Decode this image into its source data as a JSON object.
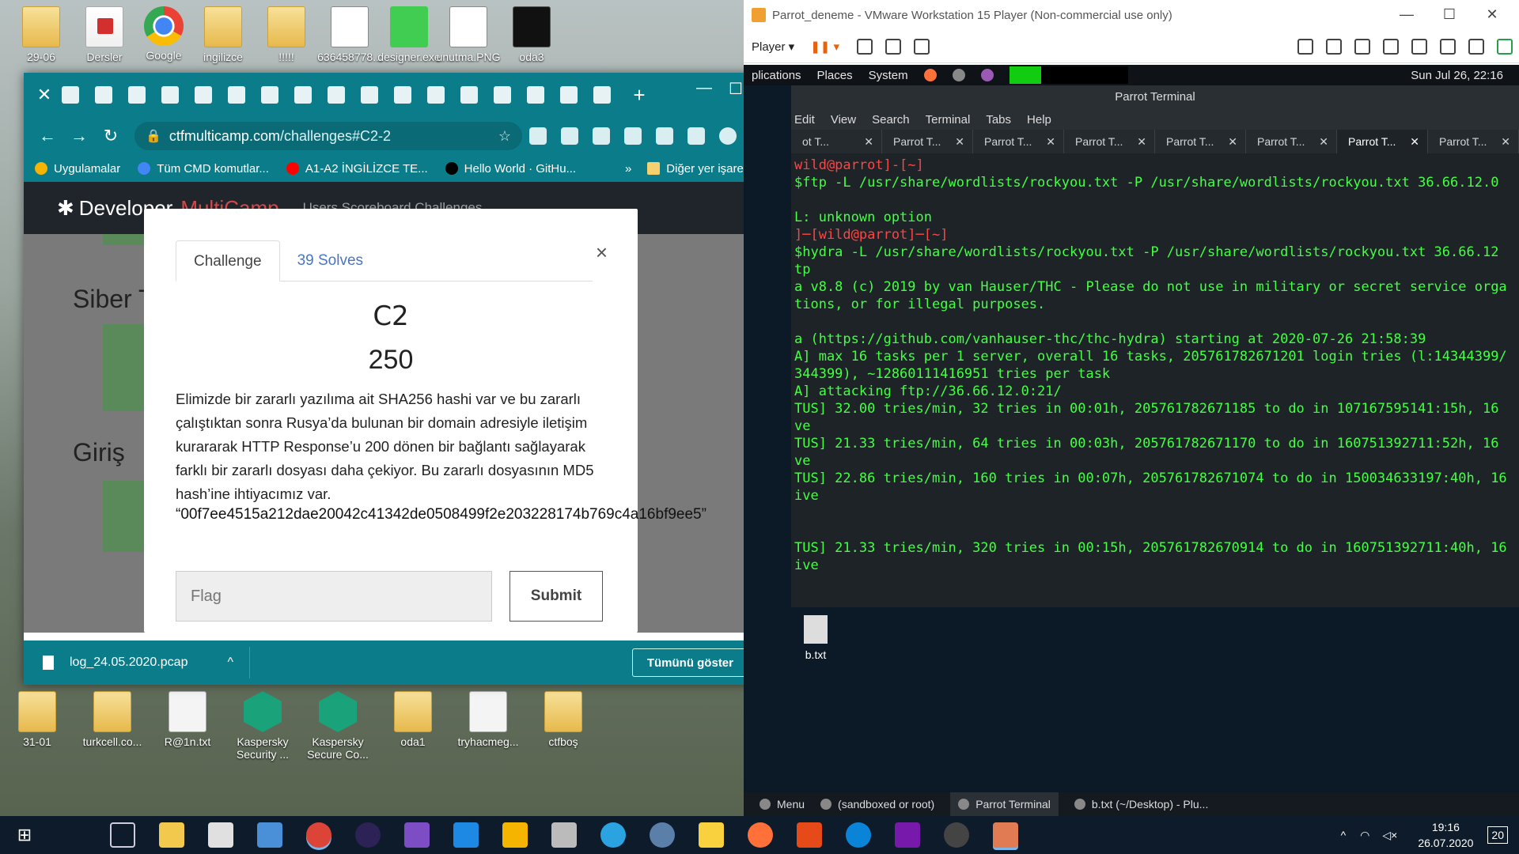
{
  "desktop": {
    "top_icons": [
      {
        "label": "29-06",
        "type": "folder"
      },
      {
        "label": "Dersler",
        "type": "pdf"
      },
      {
        "label": "Google",
        "type": "chrome"
      },
      {
        "label": "ingilizce",
        "type": "folder"
      },
      {
        "label": "!!!!!",
        "type": "folder"
      },
      {
        "label": "636458778...",
        "type": "img"
      },
      {
        "label": "designer.exe",
        "type": "qt"
      },
      {
        "label": "unutma.PNG",
        "type": "img"
      },
      {
        "label": "oda3",
        "type": "dark"
      }
    ],
    "bottom_icons": [
      {
        "label": "31-01",
        "type": "folder"
      },
      {
        "label": "turkcell.co...",
        "type": "folder"
      },
      {
        "label": "R@1n.txt",
        "type": "doc"
      },
      {
        "label": "Kaspersky Security ...",
        "type": "kas"
      },
      {
        "label": "Kaspersky Secure Co...",
        "type": "kas2"
      },
      {
        "label": "oda1",
        "type": "folder"
      },
      {
        "label": "tryhacmeg...",
        "type": "doc"
      },
      {
        "label": "ctfboş",
        "type": "folder"
      }
    ]
  },
  "chrome": {
    "tab_close": "✕",
    "new_tab": "+",
    "minimize": "—",
    "maximize": "☐",
    "close": "✕",
    "back": "←",
    "forward": "→",
    "reload": "↻",
    "url_host": "ctfmulticamp.com",
    "url_path": "/challenges#C2-2",
    "star": "☆",
    "menu": "⋮",
    "bookmarks": [
      {
        "label": "Uygulamalar",
        "color": "#f4b400"
      },
      {
        "label": "Tüm CMD komutlar...",
        "color": "#4285f4"
      },
      {
        "label": "A1-A2 İNGİLİZCE TE...",
        "color": "#ff0000"
      },
      {
        "label": "Hello World · GitHu...",
        "color": "#000000"
      }
    ],
    "more_bookmarks": "»",
    "other_bookmarks": "Diğer yer işaretleri"
  },
  "site": {
    "brand": "Developer",
    "brand_accent": "MultiCamp",
    "nav": "Users   Scoreboard   Challenges",
    "heading1": "Siber T",
    "heading2": "Giriş"
  },
  "modal": {
    "tab_challenge": "Challenge",
    "tab_solves": "39 Solves",
    "close": "×",
    "name": "C2",
    "value": "250",
    "description": "Elimizde bir zararlı yazılıma ait SHA256 hashi var ve bu zararlı çalıştıktan sonra Rusya’da bulunan bir domain adresiyle iletişim kurararak HTTP Response’u 200 dönen bir bağlantı sağlayarak farklı bir zararlı dosyası daha çekiyor. Bu zararlı dosyasının MD5 hash’ine ihtiyacımız var.",
    "hash": "“00f7ee4515a212dae20042c41342de0508499f2e203228174b769c4a16bf9ee5”",
    "flag_placeholder": "Flag",
    "submit": "Submit"
  },
  "download_bar": {
    "file": "log_24.05.2020.pcap",
    "chevron": "^",
    "show_all": "Tümünü göster",
    "close": "✕"
  },
  "vmware": {
    "title": "Parrot_deneme - VMware Workstation 15 Player (Non-commercial use only)",
    "player_menu": "Player ▾",
    "pause": "❚❚ ▾"
  },
  "guest": {
    "menus": [
      "plications",
      "Places",
      "System"
    ],
    "clock": "Sun Jul 26, 22:16",
    "terminal_title": "Parrot Terminal",
    "terminal_menu": [
      "Edit",
      "View",
      "Search",
      "Terminal",
      "Tabs",
      "Help"
    ],
    "terminal_tabs": [
      "ot T...",
      "Parrot T...",
      "Parrot T...",
      "Parrot T...",
      "Parrot T...",
      "Parrot T...",
      "Parrot T...",
      "Parrot T..."
    ],
    "terminal_active_tab": 6,
    "terminal_lines": [
      {
        "t": "wild@parrot]-[~]",
        "c": "t-red"
      },
      {
        "t": "$ftp -L /usr/share/wordlists/rockyou.txt -P /usr/share/wordlists/rockyou.txt 36.66.12.0",
        "c": "t-green"
      },
      {
        "t": "",
        "c": "t-green"
      },
      {
        "t": "L: unknown option",
        "c": "t-green"
      },
      {
        "t": "]─[wild@parrot]─[~]",
        "c": "t-red"
      },
      {
        "t": "$hydra -L /usr/share/wordlists/rockyou.txt -P /usr/share/wordlists/rockyou.txt 36.66.12",
        "c": "t-green"
      },
      {
        "t": "tp",
        "c": "t-green"
      },
      {
        "t": "a v8.8 (c) 2019 by van Hauser/THC - Please do not use in military or secret service orga",
        "c": "t-green"
      },
      {
        "t": "tions, or for illegal purposes.",
        "c": "t-green"
      },
      {
        "t": "",
        "c": "t-green"
      },
      {
        "t": "a (https://github.com/vanhauser-thc/thc-hydra) starting at 2020-07-26 21:58:39",
        "c": "t-green"
      },
      {
        "t": "A] max 16 tasks per 1 server, overall 16 tasks, 205761782671201 login tries (l:14344399/",
        "c": "t-green"
      },
      {
        "t": "344399), ~12860111416951 tries per task",
        "c": "t-green"
      },
      {
        "t": "A] attacking ftp://36.66.12.0:21/",
        "c": "t-green"
      },
      {
        "t": "TUS] 32.00 tries/min, 32 tries in 00:01h, 205761782671185 to do in 107167595141:15h, 16",
        "c": "t-green"
      },
      {
        "t": "ve",
        "c": "t-green"
      },
      {
        "t": "TUS] 21.33 tries/min, 64 tries in 00:03h, 205761782671170 to do in 160751392711:52h, 16",
        "c": "t-green"
      },
      {
        "t": "ve",
        "c": "t-green"
      },
      {
        "t": "TUS] 22.86 tries/min, 160 tries in 00:07h, 205761782671074 to do in 150034633197:40h, 16",
        "c": "t-green"
      },
      {
        "t": "ive",
        "c": "t-green"
      },
      {
        "t": "",
        "c": "t-green"
      },
      {
        "t": "",
        "c": "t-green"
      },
      {
        "t": "TUS] 21.33 tries/min, 320 tries in 00:15h, 205761782670914 to do in 160751392711:40h, 16",
        "c": "t-green"
      },
      {
        "t": "ive",
        "c": "t-green"
      }
    ],
    "desktop_file": "b.txt",
    "panel": [
      {
        "label": "Menu"
      },
      {
        "label": "(sandboxed or root)"
      },
      {
        "label": "Parrot Terminal"
      },
      {
        "label": "b.txt (~/Desktop) - Plu..."
      }
    ]
  },
  "taskbar": {
    "clock_time": "19:16",
    "clock_date": "26.07.2020",
    "notification_count": "20"
  }
}
